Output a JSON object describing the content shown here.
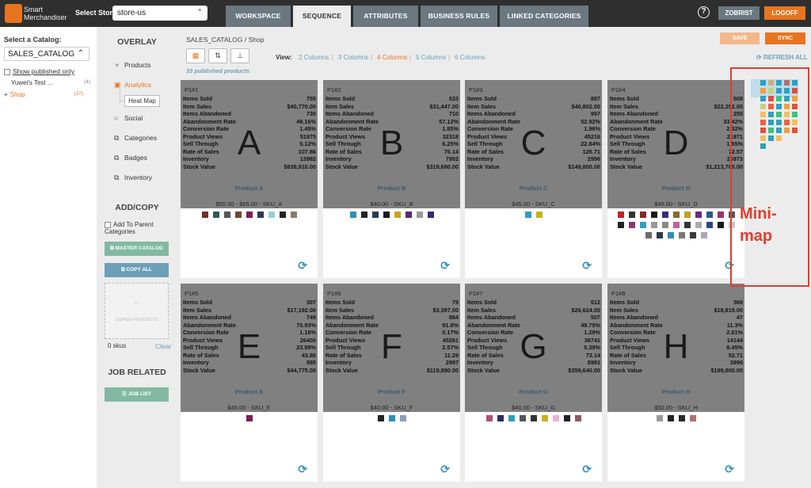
{
  "app": {
    "brand_line1": "Smart",
    "brand_line2": "Merchandiser",
    "store_label": "Select Store",
    "store_value": "store-us"
  },
  "tabs": [
    {
      "label": "WORKSPACE"
    },
    {
      "label": "SEQUENCE"
    },
    {
      "label": "ATTRIBUTES"
    },
    {
      "label": "BUSINESS RULES"
    },
    {
      "label": "LINKED CATEGORIES"
    }
  ],
  "header": {
    "help": "?",
    "user": "ZOBRIST",
    "logoff": "LOGOFF"
  },
  "left": {
    "select_catalog_label": "Select a Catalog:",
    "catalog_value": "SALES_CATALOG",
    "show_published": "Show published only",
    "tree": [
      {
        "label": "Yuwei's Test ...",
        "count": "(4)"
      },
      {
        "label": "Shop",
        "count": "(37)",
        "prefix": "+"
      }
    ]
  },
  "overlay": {
    "title": "OVERLAY",
    "items": [
      {
        "label": "Products",
        "icon": "⚬"
      },
      {
        "label": "Analytics",
        "icon": "▣"
      },
      {
        "label": "Social",
        "icon": "○"
      },
      {
        "label": "Categories",
        "icon": "⧉"
      },
      {
        "label": "Badges",
        "icon": "⧉"
      },
      {
        "label": "Inventory",
        "icon": "⧉"
      }
    ],
    "heatmap": "Heat Map"
  },
  "addcopy": {
    "title": "ADD/COPY",
    "add_parent": "Add To Parent Categories",
    "master": "MASTER CATALOG",
    "copy_all": "COPY ALL",
    "drop_text": "COPIED PRODUCTS",
    "skus": "0 skus",
    "clear": "Clear"
  },
  "job": {
    "title": "JOB RELATED",
    "job_list": "JOB LIST"
  },
  "main": {
    "breadcrumb": "SALES_CATALOG / Shop",
    "view_label": "View:",
    "views": [
      "2 Columns",
      "4 Columns",
      "4 Columns",
      "5 Columns",
      "6 Columns"
    ],
    "view_labels": {
      "a": "2 Columns",
      "b": "3 Columns",
      "c": "4 Columns",
      "d": "5 Columns",
      "e": "6 Columns"
    },
    "published": "33 published products",
    "save": "SAVE",
    "sync": "SYNC",
    "refresh": "REFRESH ALL"
  },
  "stat_labels": [
    "Items Sold",
    "Item Sales",
    "Items Abandoned",
    "Abandonment Rate",
    "Conversion Rate",
    "Product Views",
    "Sell Through",
    "Rate of Sales",
    "Inventory",
    "Stock Value"
  ],
  "products": [
    {
      "pid": "P1#1",
      "letter": "A",
      "name": "Product A",
      "price": "$55.00 - $65.00 - SKU_A",
      "stats": [
        "755",
        "$40,770.00",
        "730",
        "49.16%",
        "1.45%",
        "51975",
        "5.12%",
        "107.86",
        "13982",
        "$838,910.00"
      ]
    },
    {
      "pid": "P1#2",
      "letter": "B",
      "name": "Product B",
      "price": "$40.00 - SKU_B",
      "stats": [
        "533",
        "$31,447.00",
        "710",
        "57.12%",
        "1.85%",
        "32318",
        "6.25%",
        "76.14",
        "7992",
        "$319,680.00"
      ]
    },
    {
      "pid": "P1#3",
      "letter": "C",
      "name": "Product C",
      "price": "$45.00 - SKU_C",
      "stats": [
        "887",
        "$40,802.00",
        "997",
        "52.92%",
        "1.96%",
        "45216",
        "22.84%",
        "126.71",
        "2996",
        "$149,800.00"
      ]
    },
    {
      "pid": "P1#4",
      "letter": "D",
      "name": "Product D",
      "price": "$45.00 - SKU_D",
      "stats": [
        "508",
        "$22,352.00",
        "255",
        "33.42%",
        "2.32%",
        "21971",
        "1.55%",
        "72.57",
        "26973",
        "$1,213,785.00"
      ]
    },
    {
      "pid": "P1#5",
      "letter": "E",
      "name": "Product E",
      "price": "$45.00 - SKU_E",
      "stats": [
        "307",
        "$17,192.00",
        "749",
        "70.93%",
        "1.16%",
        "26400",
        "23.58%",
        "43.86",
        "995",
        "$44,775.00"
      ]
    },
    {
      "pid": "P1#6",
      "letter": "F",
      "name": "Product F",
      "price": "$40.00 - SKU_F",
      "stats": [
        "79",
        "$3,397.00",
        "864",
        "91.8%",
        "0.17%",
        "45261",
        "2.57%",
        "11.29",
        "2997",
        "$119,880.00"
      ]
    },
    {
      "pid": "P1#7",
      "letter": "G",
      "name": "Product G",
      "price": "$40.00 - SKU_G",
      "stats": [
        "512",
        "$26,624.00",
        "507",
        "49.75%",
        "1.29%",
        "38741",
        "5.39%",
        "73.14",
        "8991",
        "$359,640.00"
      ]
    },
    {
      "pid": "P1#8",
      "letter": "H",
      "name": "Product H",
      "price": "$50.00 - SKU_H",
      "stats": [
        "369",
        "$18,819.00",
        "47",
        "11.3%",
        "2.61%",
        "14144",
        "8.45%",
        "52.71",
        "3996",
        "$199,800.00"
      ]
    }
  ],
  "swatch_colors": [
    [
      "#7a2a2a",
      "#2e5c5a",
      "#555",
      "#6b4a2e",
      "#7a1f4f",
      "#2b3a5a",
      "#8fd3d3",
      "#222",
      "#8a7a6a"
    ],
    [
      "#2f8fc0",
      "#222",
      "#2b3a5a",
      "#1a1a1a",
      "#d4a020",
      "#5a2a6a",
      "#9a9a9a",
      "#3a2a7a"
    ],
    [
      "#2fa0c0",
      "#c8b020"
    ],
    [
      "#c82020",
      "#333",
      "#7a2a2a",
      "#1a1a1a",
      "#3a2a7a",
      "#8a6a2a",
      "#c0a020",
      "#6a2a7a",
      "#2a5a8a",
      "#a03070",
      "#555",
      "#222",
      "#8a3a6a",
      "#2fa0c0",
      "#999",
      "#8a8a8a",
      "#c060a0",
      "#333",
      "#aaa",
      "#2a4a7a",
      "#1a1a1a",
      "#c8c8c8",
      "#6a6a6a",
      "#2a3a4a",
      "#2f8fc0",
      "#777",
      "#3a3a3a",
      "#aaa"
    ],
    [
      "#7a1f4f"
    ],
    [
      "#222",
      "#2f8fc0",
      "#8aa0c0"
    ],
    [
      "#b05070",
      "#2a2a6a",
      "#2fa0c0",
      "#555",
      "#333",
      "#c8b020",
      "#f0b0d0",
      "#222",
      "#8a5a5a"
    ],
    [
      "#999",
      "#222",
      "#2a2a2a",
      "#b07070"
    ]
  ],
  "minimap": {
    "label": "Mini-\nmap"
  }
}
